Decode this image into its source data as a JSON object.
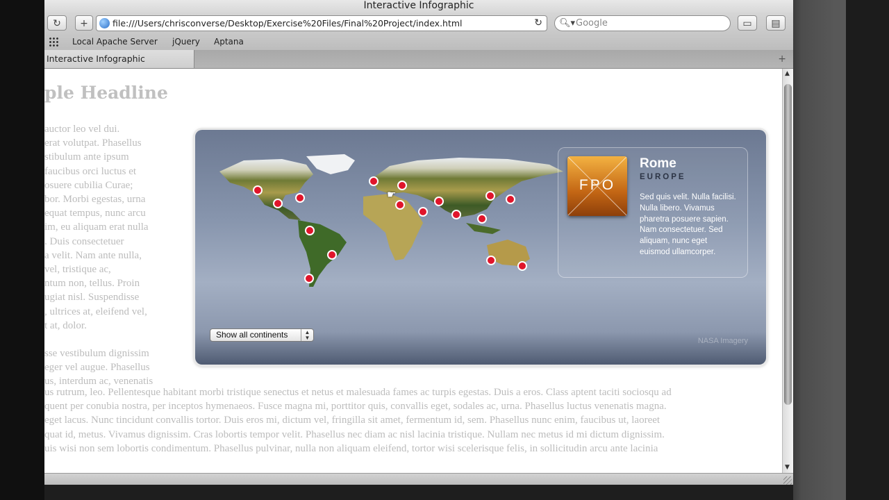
{
  "window": {
    "title": "Interactive Infographic"
  },
  "toolbar": {
    "back_icon": "reload-icon",
    "url": "file:///Users/chrisconverse/Desktop/Exercise%20Files/Final%20Project/index.html",
    "search_placeholder": "Google"
  },
  "bookmarks": {
    "items": [
      "Local Apache Server",
      "jQuery",
      "Aptana"
    ]
  },
  "tabs": [
    {
      "label": "Interactive Infographic"
    }
  ],
  "page": {
    "headline": "ple Headline",
    "side_lines": [
      "auctor leo vel dui.",
      "erat volutpat. Phasellus",
      "stibulum ante ipsum",
      "faucibus orci luctus et",
      "osuere cubilia Curae;",
      "bor. Morbi egestas, urna",
      "equat tempus, nunc arcu",
      "im, eu aliquam erat nulla",
      ". Duis consectetuer",
      "a velit. Nam ante nulla,",
      "vel, tristique ac,",
      "ntum non, tellus. Proin",
      "ugiat nisl. Suspendisse",
      ", ultrices at, eleifend vel,",
      "t at, dolor.",
      "",
      "sse vestibulum dignissim",
      "eger vel augue. Phasellus",
      "us, interdum ac, venenatis"
    ],
    "bottom_lines": [
      "us rutrum, leo. Pellentesque habitant morbi tristique senectus et netus et malesuada fames ac turpis egestas. Duis a eros. Class aptent taciti sociosqu ad",
      "quent per conubia nostra, per inceptos hymenaeos. Fusce magna mi, porttitor quis, convallis eget, sodales ac, urna. Phasellus luctus venenatis magna.",
      " eget lacus. Nunc tincidunt convallis tortor. Duis eros mi, dictum vel, fringilla sit amet, fermentum id, sem. Phasellus nunc enim, faucibus ut, laoreet",
      "quat id, metus. Vivamus dignissim. Cras lobortis tempor velit. Phasellus nec diam ac nisl lacinia tristique. Nullam nec metus id mi dictum dignissim.",
      "uis wisi non sem lobortis condimentum. Phasellus pulvinar, nulla non aliquam eleifend, tortor wisi scelerisque felis, in sollicitudin arcu ante lacinia"
    ]
  },
  "infographic": {
    "city": "Rome",
    "region": "EUROPE",
    "description": "Sed quis velit. Nulla facilisi. Nulla libero. Vivamus pharetra posuere sapien. Nam consectetuer. Sed aliquam, nunc eget euismod ullamcorper.",
    "thumb_label": "FPO",
    "select_label": "Show all continents",
    "credit": "NASA Imagery",
    "marker_color": "#e0152b"
  }
}
